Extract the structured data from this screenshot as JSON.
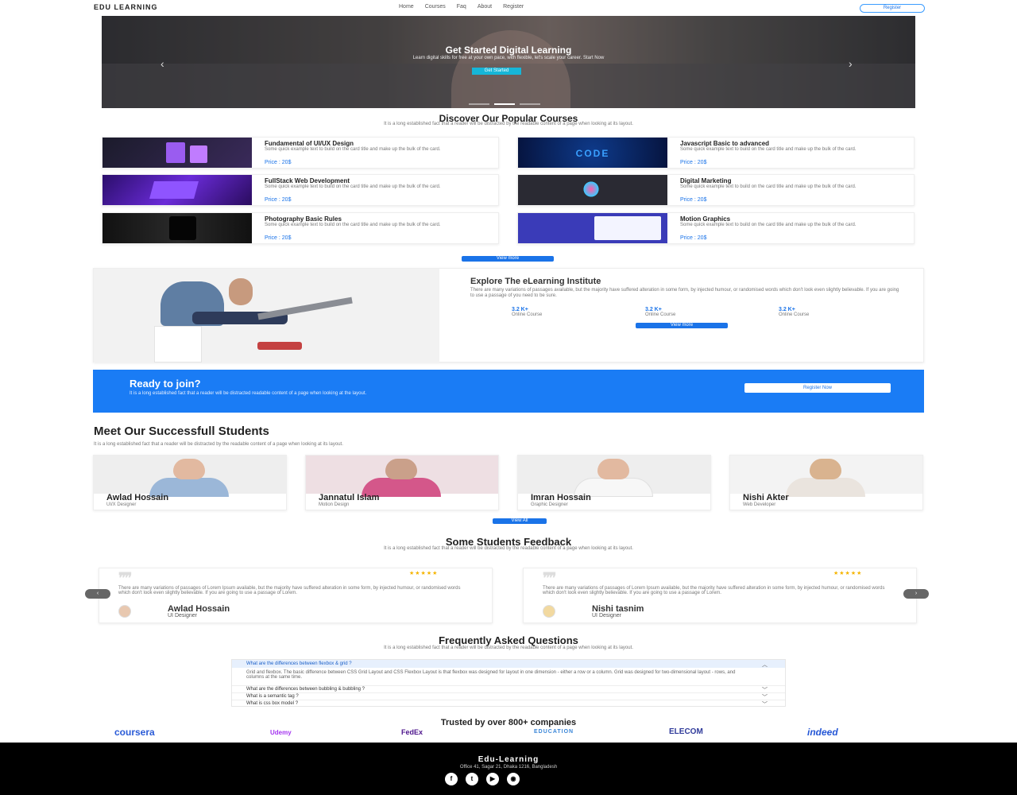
{
  "nav": {
    "logo": "EDU LEARNING",
    "items": [
      "Home",
      "Courses",
      "Faq",
      "About",
      "Register"
    ],
    "register_button": "Register"
  },
  "hero": {
    "title": "Get Started Digital Learning",
    "subtitle": "Learn digital skills for free at your own pace, with flexible, let's scale your career. Start Now",
    "button": "Get Started",
    "prev_icon": "chevron-left-icon",
    "next_icon": "chevron-right-icon"
  },
  "courses": {
    "title": "Discover Our Popular Courses",
    "subtitle": "It is a long established fact that a reader will be distracted by the readable content of a page when looking at its layout.",
    "items": [
      {
        "title": "Fundamental of UI/UX Design",
        "desc": "Some quick example text to build on the card title and make up the bulk of the card.",
        "price": "Price : 20$"
      },
      {
        "title": "Javascript Basic to advanced",
        "desc": "Some quick example text to build on the card title and make up the bulk of the card.",
        "price": "Price : 20$",
        "thumb_text": "CODE"
      },
      {
        "title": "FullStack Web Development",
        "desc": "Some quick example text to build on the card title and make up the bulk of the card.",
        "price": "Price : 20$"
      },
      {
        "title": "Digital Marketing",
        "desc": "Some quick example text to build on the card title and make up the bulk of the card.",
        "price": "Price : 20$"
      },
      {
        "title": "Photography Basic Rules",
        "desc": "Some quick example text to build on the card title and make up the bulk of the card.",
        "price": "Price : 20$"
      },
      {
        "title": "Motion Graphics",
        "desc": "Some quick example text to build on the card title and make up the bulk of the card.",
        "price": "Price : 20$"
      }
    ],
    "view_more": "View more"
  },
  "explore": {
    "title": "Explore The eLearning Institute",
    "text": "There are many variations of passages available, but the majority have suffered alteration in some form, by injected humour, or randomised words which don't look even slightly believable. If you are going to use a passage of you need to be sure.",
    "stats": [
      {
        "num": "3.2 K+",
        "label": "Online Course"
      },
      {
        "num": "3.2 K+",
        "label": "Online Course"
      },
      {
        "num": "3.2 K+",
        "label": "Online Course"
      }
    ],
    "button": "View more"
  },
  "ready": {
    "title": "Ready to join?",
    "subtitle": "It is a long established fact that a reader will be distracted readable content of a page when looking at the layout.",
    "button": "Register Now"
  },
  "students": {
    "title": "Meet Our Successfull Students",
    "subtitle": "It is a long established fact that a reader will be distracted by the readable content of a page when looking at its layout.",
    "items": [
      {
        "name": "Awlad Hossain",
        "role": "UI/X Designer"
      },
      {
        "name": "Jannatul Islam",
        "role": "Motion Design"
      },
      {
        "name": "Imran Hossain",
        "role": "Graphic Designer"
      },
      {
        "name": "Nishi Akter",
        "role": "Web Developer"
      }
    ],
    "view_all": "View All"
  },
  "feedback": {
    "title": "Some Students Feedback",
    "subtitle": "It is a long established fact that a reader will be distracted by the readable content of a page when looking at its layout.",
    "items": [
      {
        "text": "There are many variations of passages of Lorem Ipsum available, but the majority have suffered alteration in some form, by injected humour, or randomised words which don't look even slightly believable. If you are going to use a passage of Lorem.",
        "name": "Awlad Hossain",
        "role": "UI Designer",
        "rating": 5
      },
      {
        "text": "There are many variations of passages of Lorem Ipsum available, but the majority have suffered alteration in some form, by injected humour, or randomised words which don't look even slightly believable. If you are going to use a passage of Lorem.",
        "name": "Nishi tasnim",
        "role": "UI Designer",
        "rating": 5
      }
    ],
    "stars": "★★★★★",
    "quote_mark": "❞❞",
    "prev": "‹",
    "next": "›"
  },
  "faq": {
    "title": "Frequently Asked Questions",
    "subtitle": "It is a long established fact that a reader will be distracted by the readable content of a page when looking at its layout.",
    "items": [
      {
        "q": "What are the differences between flexbox & grid ?",
        "a": "Grid and flexbox. The basic difference between CSS Grid Layout and CSS Flexbox Layout is that flexbox was designed for layout in one dimension - either a row or a column. Grid was designed for two-dimensional layout - rows, and columns at the same time.",
        "open": true
      },
      {
        "q": "What are the differences between bubbling & bubbling ?",
        "open": false
      },
      {
        "q": "What is a semantic tag ?",
        "open": false
      },
      {
        "q": "What is css box model ?",
        "open": false
      }
    ]
  },
  "trusted": {
    "title": "Trusted by over 800+ companies",
    "brands": [
      "coursera",
      "Udemy",
      "FedEx",
      "EDUCATION",
      "ELECOM",
      "indeed"
    ]
  },
  "footer": {
    "logo": "Edu-Learning",
    "address": "Office 41, Sagar 21, Dhaka 1216, Bangladesh",
    "social": [
      "facebook-icon",
      "twitter-icon",
      "youtube-icon",
      "github-icon"
    ]
  },
  "colors": {
    "accent": "#1a73e8",
    "ready_bg": "#1a7cf5",
    "hero_button": "#16b6d8",
    "footer_bg": "#000000",
    "star": "#f5b400"
  }
}
